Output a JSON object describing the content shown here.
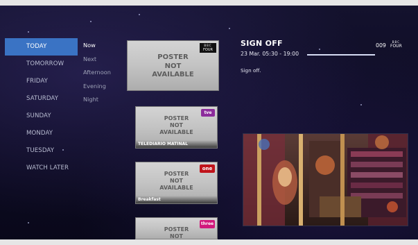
{
  "days": [
    {
      "label": "TODAY",
      "active": true
    },
    {
      "label": "TOMORROW",
      "active": false
    },
    {
      "label": "FRIDAY",
      "active": false
    },
    {
      "label": "SATURDAY",
      "active": false
    },
    {
      "label": "SUNDAY",
      "active": false
    },
    {
      "label": "MONDAY",
      "active": false
    },
    {
      "label": "TUESDAY",
      "active": false
    },
    {
      "label": "WATCH LATER",
      "active": false
    }
  ],
  "times": [
    {
      "label": "Now",
      "active": true
    },
    {
      "label": "Next",
      "active": false
    },
    {
      "label": "Afternoon",
      "active": false
    },
    {
      "label": "Evening",
      "active": false
    },
    {
      "label": "Night",
      "active": false
    }
  ],
  "posters": [
    {
      "placeholder": "POSTER\nNOT\nAVAILABLE",
      "caption": "",
      "channel_logo": "BBC FOUR"
    },
    {
      "placeholder": "POSTER\nNOT\nAVAILABLE",
      "caption": "TELEDIARIO MATINAL",
      "channel_logo": "tve"
    },
    {
      "placeholder": "POSTER\nNOT\nAVAILABLE",
      "caption": "Breakfast",
      "channel_logo": "BBC one"
    },
    {
      "placeholder": "POSTER\nNOT",
      "caption": "",
      "channel_logo": "BBC three"
    }
  ],
  "detail": {
    "title": "SIGN OFF",
    "time": "23 Mar. 05:30 - 19:00",
    "description": "Sign off.",
    "channel_number": "009",
    "channel_logo": "BBC FOUR",
    "progress": 1.0
  },
  "preview": {
    "icon": "video-preview",
    "accent": "#3a73c4"
  }
}
